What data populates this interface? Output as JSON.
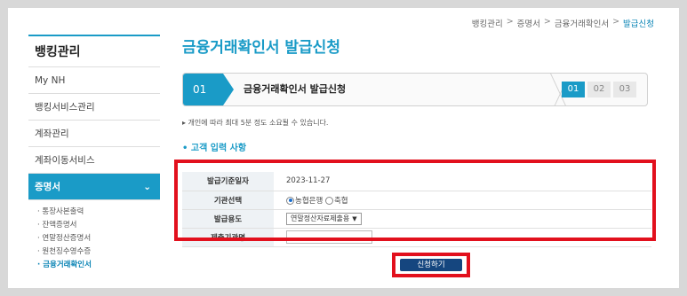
{
  "breadcrumb": {
    "items": [
      "뱅킹관리",
      "증명서",
      "금융거래확인서",
      "발급신청"
    ],
    "separator": ">"
  },
  "sidebar": {
    "title": "뱅킹관리",
    "items": [
      {
        "label": "My NH"
      },
      {
        "label": "뱅킹서비스관리"
      },
      {
        "label": "계좌관리"
      },
      {
        "label": "계좌이동서비스"
      },
      {
        "label": "증명서",
        "expanded_icon": "chevron-down-icon"
      }
    ],
    "sub_items": [
      "· 통장사본출력",
      "· 잔액증명서",
      "· 연말정산증명서",
      "· 원천징수영수증",
      "· 금융거래확인서"
    ]
  },
  "page": {
    "title": "금융거래확인서 발급신청"
  },
  "stepbar": {
    "current_num": "01",
    "current_label": "금융거래확인서 발급신청",
    "steps": [
      "01",
      "02",
      "03"
    ]
  },
  "note": "▸ 개인에 따라 최대 5분 정도 소요될 수 있습니다.",
  "section": {
    "heading": "• 고객 입력 사항"
  },
  "form": {
    "issue_date_label": "발급기준일자",
    "issue_date_value": "2023-11-27",
    "institution_label": "기관선택",
    "institution_options": [
      "농협은행",
      "축협"
    ],
    "institution_selected": "농협은행",
    "purpose_label": "발급용도",
    "purpose_value": "연말정산자료제출용",
    "submit_org_label": "제출기관명",
    "submit_org_value": ""
  },
  "actions": {
    "submit_label": "신청하기"
  },
  "colors": {
    "accent": "#1a9bc7",
    "highlight": "#e2101d",
    "button": "#15467f"
  }
}
